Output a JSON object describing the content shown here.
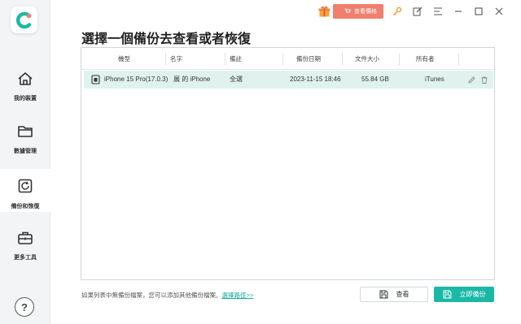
{
  "app": {
    "logo_icon": "app-logo-icon",
    "accent_color": "#1bb8a6"
  },
  "sidebar": {
    "items": [
      {
        "label": "我的裝置",
        "icon": "home-icon"
      },
      {
        "label": "數據管理",
        "icon": "folder-icon"
      },
      {
        "label": "備份和恢復",
        "icon": "backup-restore-icon",
        "active": true
      },
      {
        "label": "更多工具",
        "icon": "toolbox-icon"
      }
    ],
    "help_label": "?"
  },
  "topbar": {
    "price_button": "查看價格",
    "icons": [
      "gift-icon",
      "key-icon",
      "edit-icon",
      "menu-icon",
      "minimize-icon",
      "maximize-icon",
      "close-icon"
    ]
  },
  "main": {
    "title": "選擇一個備份去查看或者恢復",
    "table": {
      "columns": [
        "機型",
        "名字",
        "備註",
        "備份日期",
        "文件大小",
        "所有者"
      ],
      "rows": [
        {
          "model": "iPhone 15 Pro(17.0.3)",
          "name": "展 的 iPhone",
          "note": "全選",
          "date": "2023-11-15 18:46",
          "size": "55.84 GB",
          "owner": "iTunes"
        }
      ]
    }
  },
  "footer": {
    "hint_text": "如果列表中無備份檔案，您可以添加其他備份檔案。",
    "link_text": "選擇路徑>>",
    "view_button": "查看",
    "backup_button": "立即備份"
  }
}
